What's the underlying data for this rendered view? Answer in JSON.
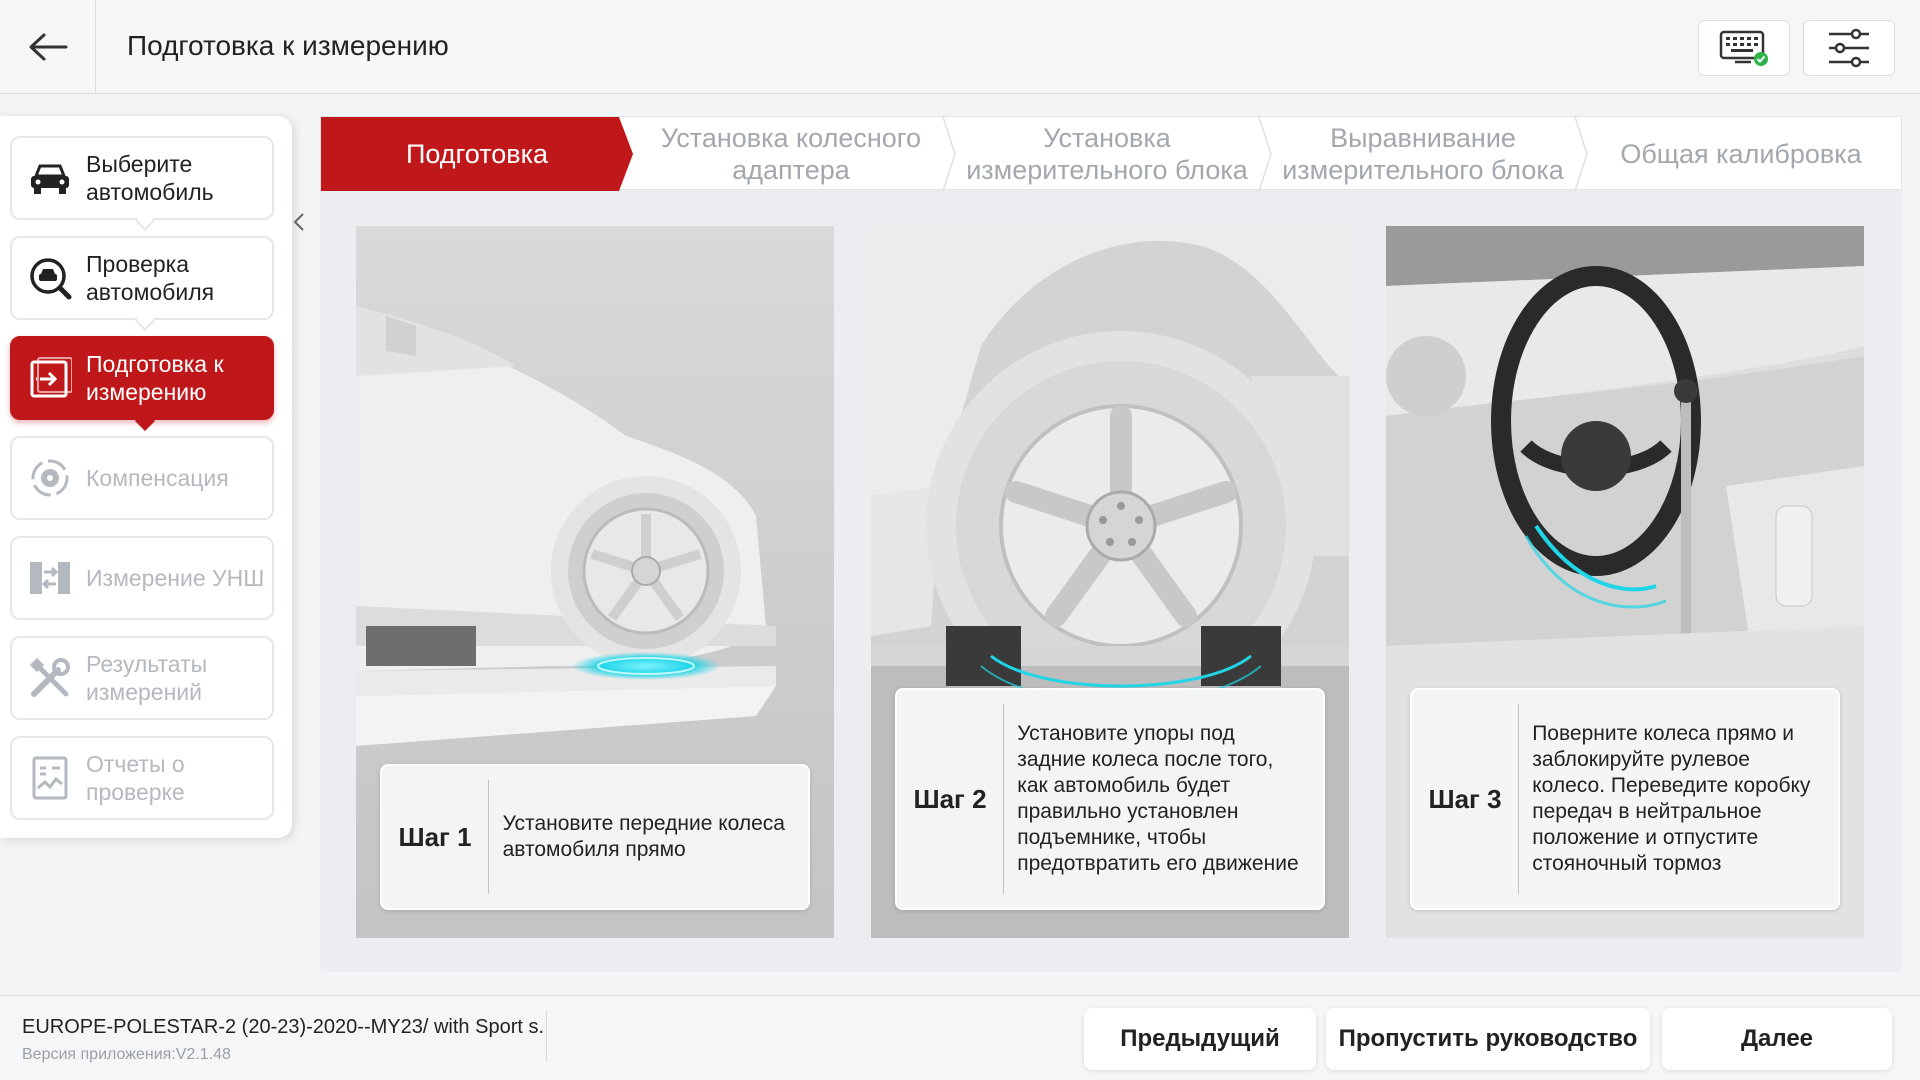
{
  "header": {
    "title": "Подготовка к измерению",
    "back_icon": "arrow-left-icon",
    "vci_icon": "keyboard-connected-icon",
    "settings_icon": "sliders-icon"
  },
  "sidebar": {
    "items": [
      {
        "label": "Выберите автомобиль",
        "icon": "car-icon",
        "state": "done"
      },
      {
        "label": "Проверка автомобиля",
        "icon": "car-search-icon",
        "state": "done"
      },
      {
        "label": "Подготовка к измерению",
        "icon": "prepare-icon",
        "state": "active"
      },
      {
        "label": "Компенсация",
        "icon": "compensation-icon",
        "state": "disabled"
      },
      {
        "label": "Измерение УНШ",
        "icon": "alignment-icon",
        "state": "disabled"
      },
      {
        "label": "Результаты измерений",
        "icon": "tools-icon",
        "state": "disabled"
      },
      {
        "label": "Отчеты о проверке",
        "icon": "report-icon",
        "state": "disabled"
      }
    ]
  },
  "tabs": [
    {
      "label": "Подготовка",
      "active": true
    },
    {
      "label": "Установка колесного адаптера",
      "active": false
    },
    {
      "label": "Установка измерительного блока",
      "active": false
    },
    {
      "label": "Выравнивание измерительного блока",
      "active": false
    },
    {
      "label": "Общая калибровка",
      "active": false
    }
  ],
  "steps": [
    {
      "step_label": "Шаг 1",
      "text": "Установите передние колеса автомобиля прямо"
    },
    {
      "step_label": "Шаг 2",
      "text": "Установите упоры под задние колеса после того, как автомобиль будет правильно установлен подъемнике, чтобы предотвратить его движение"
    },
    {
      "step_label": "Шаг 3",
      "text": "Поверните колеса прямо и заблокируйте рулевое колесо. Переведите коробку передач в нейтральное положение и отпустите стояночный тормоз"
    }
  ],
  "footer": {
    "model": "EUROPE-POLESTAR-2 (20-23)-2020--MY23/ with Sport s.",
    "version": "Версия приложения:V2.1.48",
    "prev_label": "Предыдущий",
    "skip_label": "Пропустить руководство",
    "next_label": "Далее"
  },
  "colors": {
    "accent": "#c0181a",
    "accent_glow": "#20d5e8",
    "disabled_text": "#b4b9c0"
  }
}
